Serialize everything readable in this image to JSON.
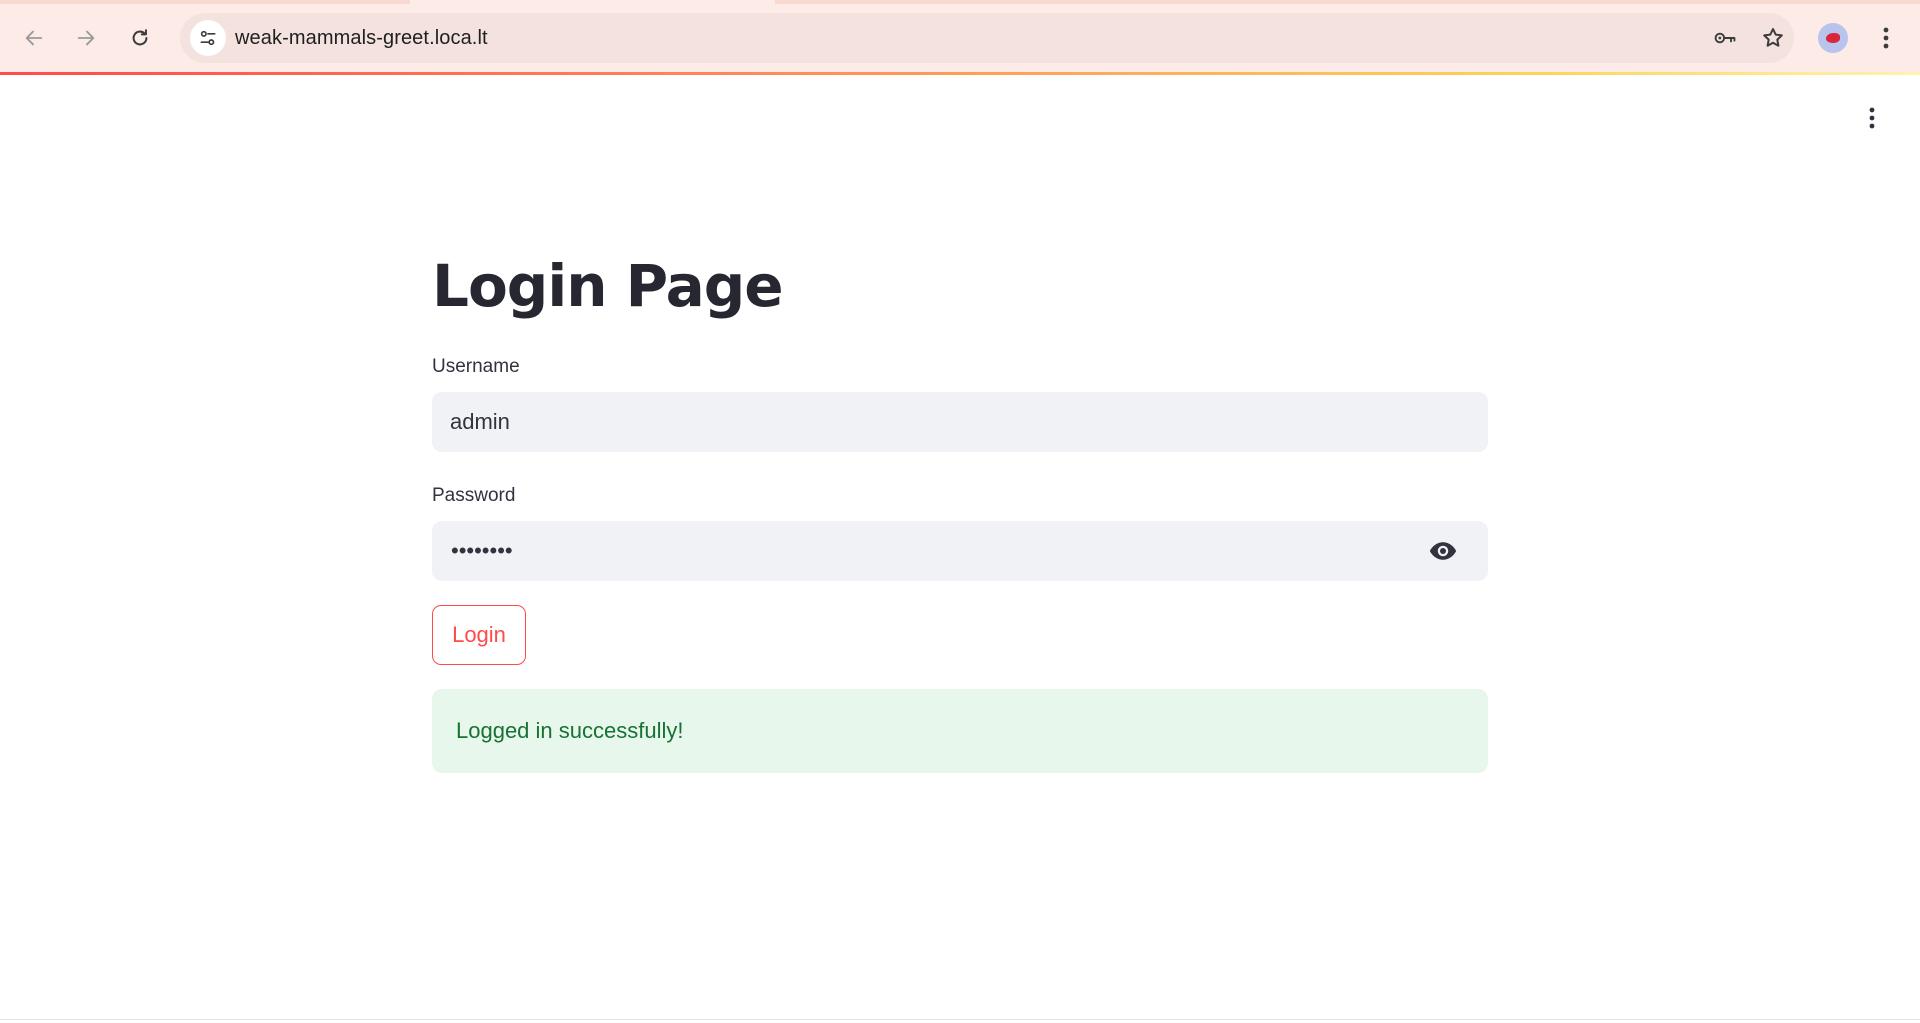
{
  "browser": {
    "url": "weak-mammals-greet.loca.lt",
    "icons": {
      "back": "arrow-left-icon",
      "forward": "arrow-right-icon",
      "reload": "reload-icon",
      "site_info": "tune-icon",
      "password_manager": "key-icon",
      "bookmark": "star-icon",
      "profile": "avatar",
      "menu": "kebab-menu-icon"
    }
  },
  "page": {
    "title": "Login Page",
    "username": {
      "label": "Username",
      "value": "admin"
    },
    "password": {
      "label": "Password",
      "masked_value": "••••••••"
    },
    "login_button": "Login",
    "success_message": "Logged in successfully!"
  },
  "colors": {
    "accent": "#ff4b4b",
    "success_bg": "#e7f7ec",
    "success_text": "#177233",
    "input_bg": "#f0f2f6",
    "text": "#31333f"
  }
}
